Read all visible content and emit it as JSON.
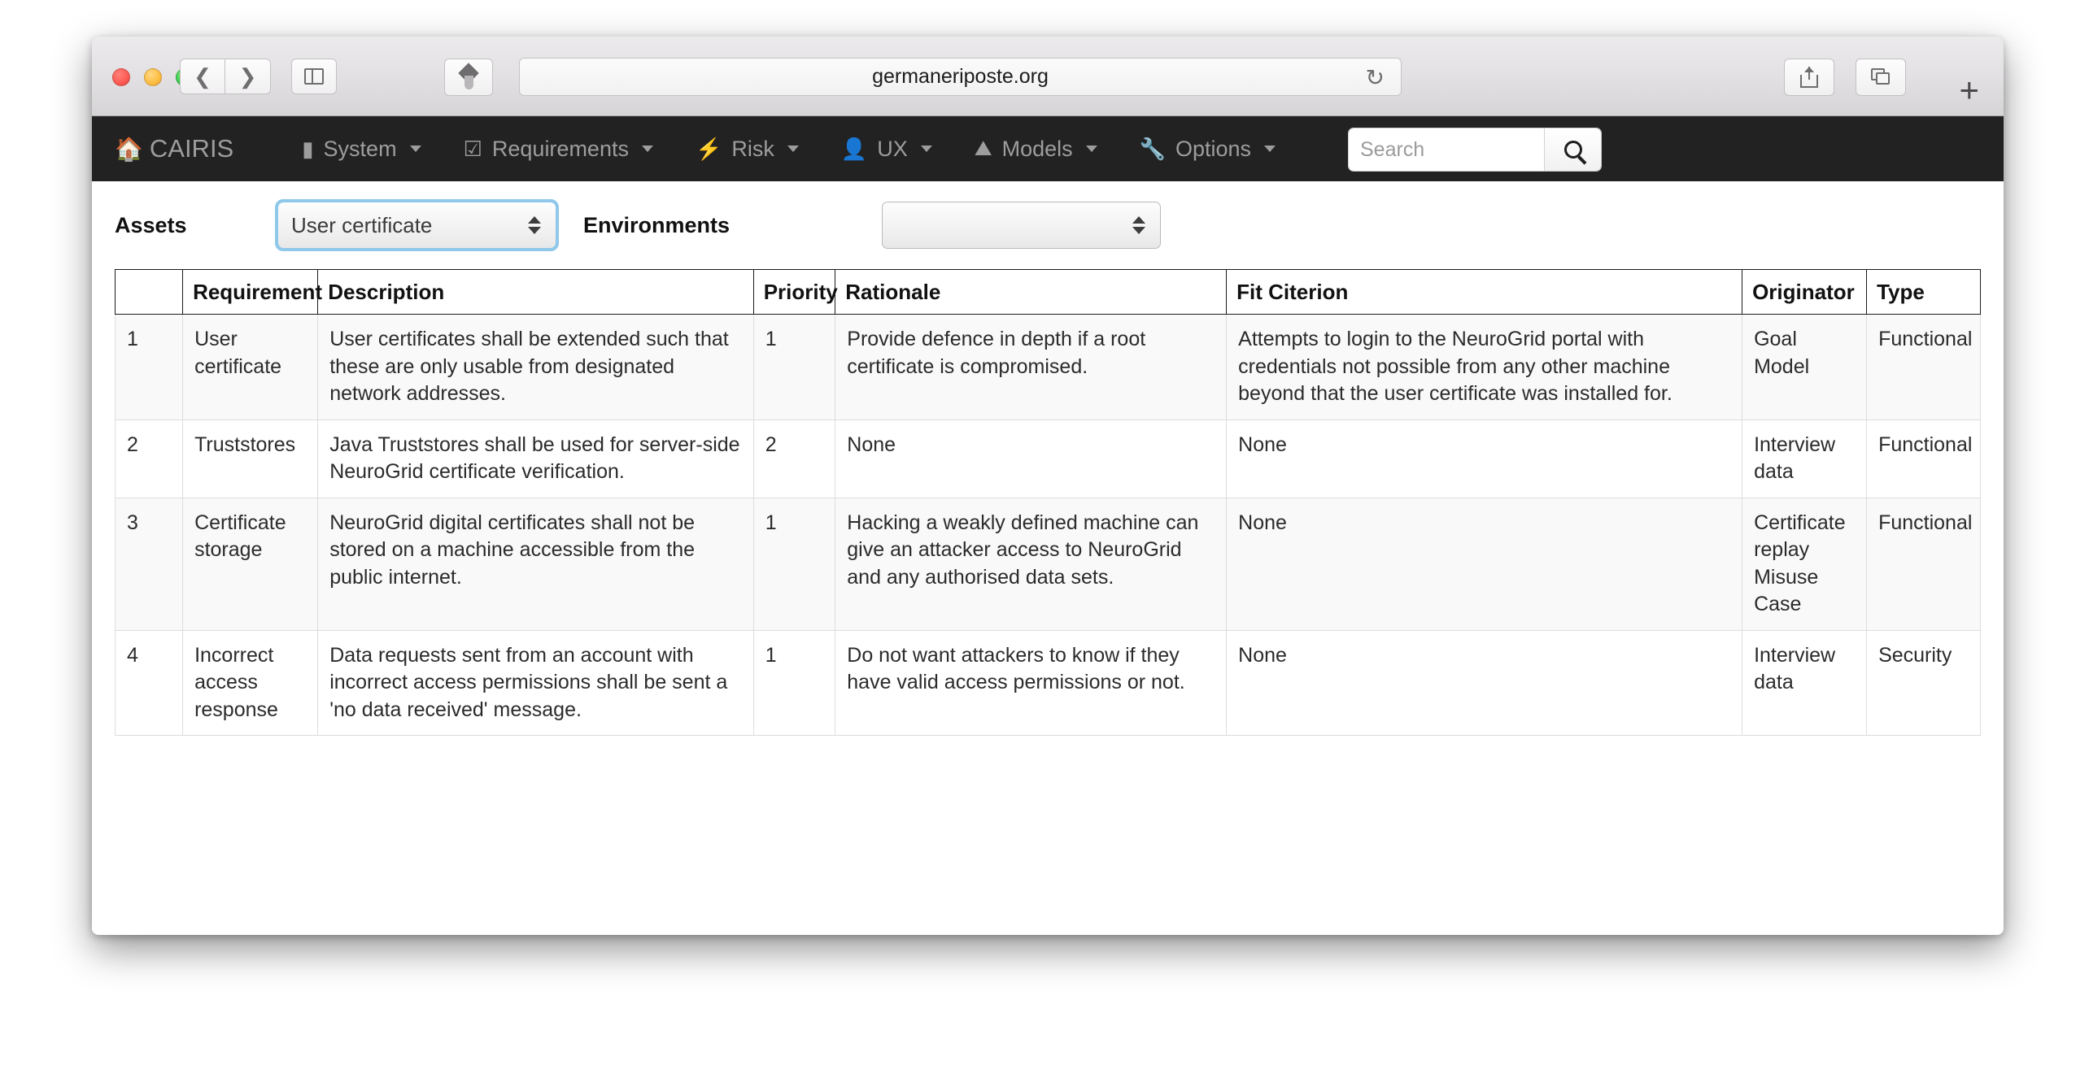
{
  "browser": {
    "url": "germaneriposte.org",
    "back_icon": "chevron-left-icon",
    "forward_icon": "chevron-right-icon",
    "sidebar_icon": "sidebar-icon",
    "pen_icon": "pen-icon",
    "reload_icon": "reload-icon",
    "share_icon": "share-icon",
    "tabs_icon": "tabs-icon",
    "new_tab_label": "+"
  },
  "navbar": {
    "brand": "CAIRIS",
    "brand_icon": "home-icon",
    "items": [
      {
        "label": "System",
        "icon": "book-icon",
        "glyph": "▮"
      },
      {
        "label": "Requirements",
        "icon": "checklist-icon",
        "glyph": "☑"
      },
      {
        "label": "Risk",
        "icon": "bolt-icon",
        "glyph": "⚡"
      },
      {
        "label": "UX",
        "icon": "person-icon",
        "glyph": "👤"
      },
      {
        "label": "Models",
        "icon": "image-icon",
        "glyph": "⛰"
      },
      {
        "label": "Options",
        "icon": "wrench-icon",
        "glyph": "🔧"
      }
    ],
    "search": {
      "placeholder": "Search",
      "value": "",
      "button_icon": "search-icon"
    }
  },
  "filters": {
    "assets_label": "Assets",
    "assets_value": "User certificate",
    "assets_focused": true,
    "environments_label": "Environments",
    "environments_value": ""
  },
  "table": {
    "columns": [
      {
        "key": "idx",
        "label": ""
      },
      {
        "key": "req",
        "label": "Requirement"
      },
      {
        "key": "desc",
        "label": "Description"
      },
      {
        "key": "pri",
        "label": "Priority"
      },
      {
        "key": "rat",
        "label": "Rationale"
      },
      {
        "key": "fit",
        "label": "Fit Citerion"
      },
      {
        "key": "org",
        "label": "Originator"
      },
      {
        "key": "type",
        "label": "Type"
      }
    ],
    "rows": [
      {
        "idx": "1",
        "req": "User certificate",
        "desc": "User certificates shall be extended such that these are only usable from designated network addresses.",
        "pri": "1",
        "rat": "Provide defence in depth if a root certificate is compromised.",
        "fit": "Attempts to login to the NeuroGrid portal with credentials not possible from any other machine beyond that the user certificate was installed for.",
        "org": "Goal Model",
        "type": "Functional"
      },
      {
        "idx": "2",
        "req": "Truststores",
        "desc": "Java Truststores shall be used for server-side NeuroGrid certificate verification.",
        "pri": "2",
        "rat": "None",
        "fit": "None",
        "org": "Interview data",
        "type": "Functional"
      },
      {
        "idx": "3",
        "req": "Certificate storage",
        "desc": "NeuroGrid digital certificates shall not be stored on a machine accessible from the public internet.",
        "pri": "1",
        "rat": "Hacking a weakly defined machine can give an attacker access to NeuroGrid and any authorised data sets.",
        "fit": "None",
        "org": "Certificate replay Misuse Case",
        "type": "Functional"
      },
      {
        "idx": "4",
        "req": "Incorrect access response",
        "desc": "Data requests sent from an account with incorrect access permissions shall be sent a 'no data received' message.",
        "pri": "1",
        "rat": "Do not want attackers to know if they have valid access permissions or not.",
        "fit": "None",
        "org": "Interview data",
        "type": "Security"
      }
    ]
  },
  "colors": {
    "navbar_bg": "#222222",
    "navbar_text": "#9d9d9d",
    "focus_ring": "#8fc8ea",
    "row_alt_bg": "#f9f9f9"
  }
}
